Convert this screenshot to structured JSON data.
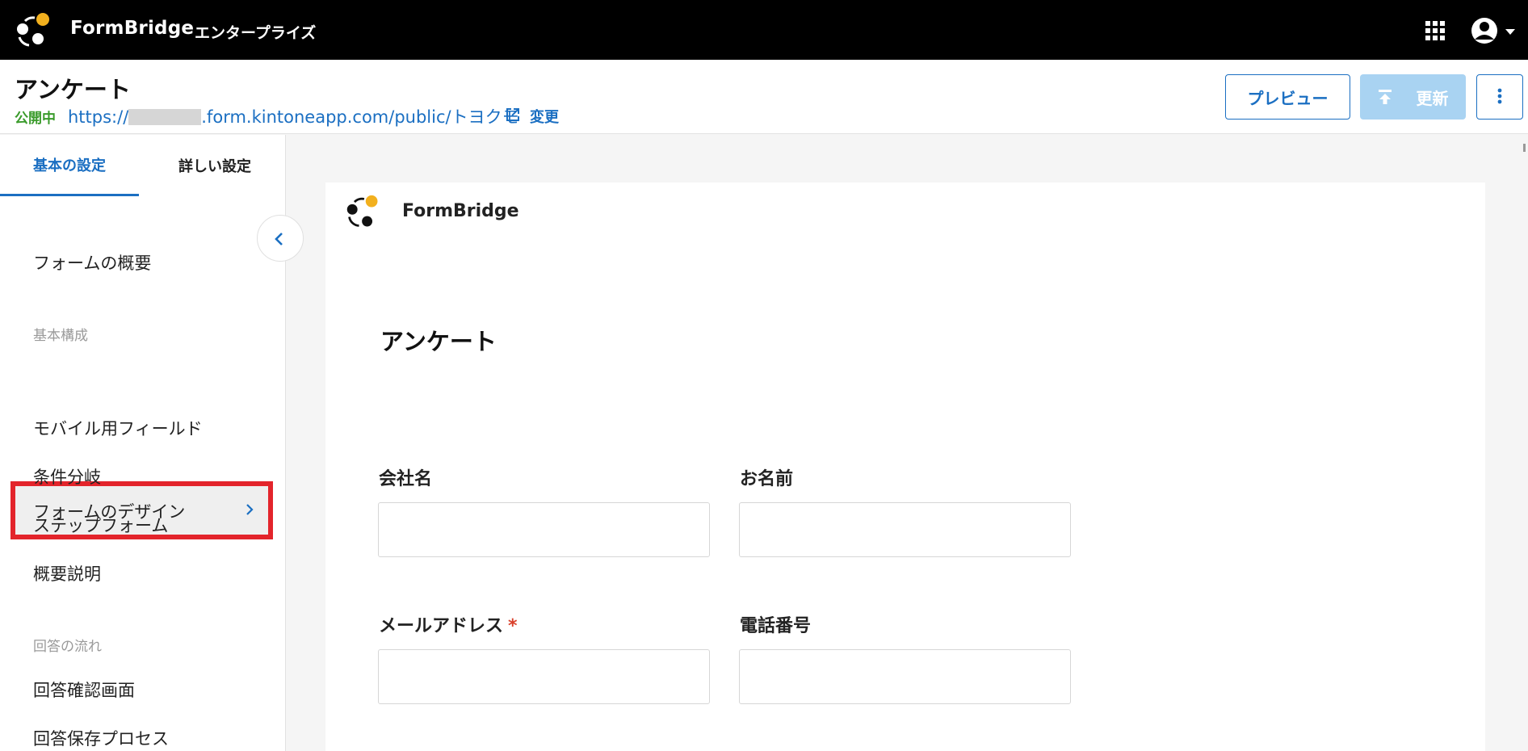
{
  "topbar": {
    "brand": "FormBridge",
    "edition": "エンタープライズ",
    "icons": {
      "apps": "apps-grid-icon",
      "account": "account-circle-icon"
    }
  },
  "header": {
    "title": "アンケート",
    "status": "公開中",
    "url_prefix": "https://",
    "url_suffix": ".form.kintoneapp.com/public/トヨクモ",
    "change_label": "変更",
    "preview_label": "プレビュー",
    "update_label": "更新"
  },
  "sidebar": {
    "tabs": [
      {
        "label": "基本の設定",
        "active": true
      },
      {
        "label": "詳しい設定",
        "active": false
      }
    ],
    "overview": "フォームの概要",
    "section_basic": "基本構成",
    "active_item": "フォームのデザイン",
    "items_basic": [
      "モバイル用フィールド",
      "条件分岐",
      "ステップフォーム",
      "概要説明"
    ],
    "section_flow": "回答の流れ",
    "items_flow": [
      "回答確認画面",
      "回答保存プロセス"
    ]
  },
  "form": {
    "brand": "FormBridge",
    "title": "アンケート",
    "fields": [
      {
        "label": "会社名",
        "required": false
      },
      {
        "label": "お名前",
        "required": false
      },
      {
        "label": "メールアドレス",
        "required": true,
        "required_mark": "*"
      },
      {
        "label": "電話番号",
        "required": false
      }
    ]
  },
  "colors": {
    "accent": "#1b6fc2",
    "status_green": "#3a9b2b",
    "highlight_red": "#e3242b",
    "logo_yellow": "#f2b01e",
    "update_disabled": "#a9d3f2"
  }
}
